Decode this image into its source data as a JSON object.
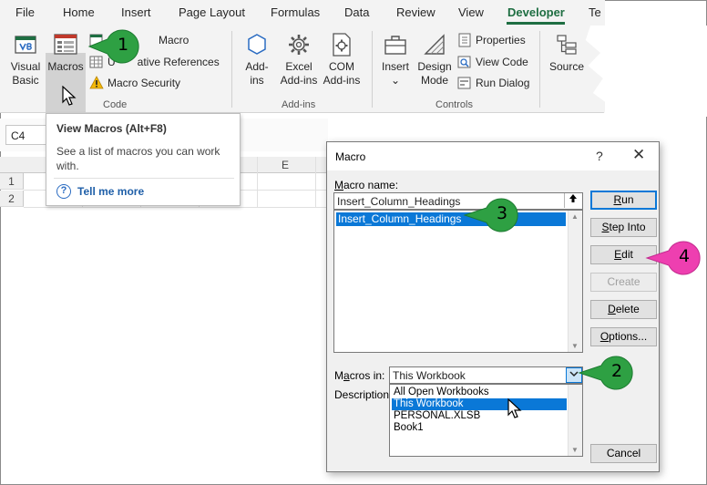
{
  "ribbon": {
    "tabs": [
      "File",
      "Home",
      "Insert",
      "Page Layout",
      "Formulas",
      "Data",
      "Review",
      "View",
      "Developer",
      "Te"
    ],
    "active_tab": "Developer",
    "accent": "#1e6e42",
    "code_group": {
      "visual_basic": [
        "Visual",
        "Basic"
      ],
      "macros": "Macros",
      "record_macro": "Macro",
      "relative_refs": "Use Relative References",
      "relative_refs_visible": "ative References",
      "relative_refs_prefix": "U",
      "macro_security": "Macro Security",
      "label": "Code"
    },
    "addins_group": {
      "addins": [
        "Add-",
        "ins"
      ],
      "excel_addins": [
        "Excel",
        "Add-ins"
      ],
      "com_addins": [
        "COM",
        "Add-ins"
      ],
      "label": "Add-ins"
    },
    "controls_group": {
      "insert": "Insert",
      "design_mode": [
        "Design",
        "Mode"
      ],
      "properties": "Properties",
      "view_code": "View Code",
      "run_dialog": "Run Dialog",
      "label": "Controls"
    },
    "xml_group": {
      "source": "Source"
    }
  },
  "sheet": {
    "name_box": "C4",
    "column_e": "E",
    "rows": [
      "1",
      "2"
    ]
  },
  "tooltip": {
    "title": "View Macros (Alt+F8)",
    "description": "See a list of macros you can work with.",
    "link": "Tell me more"
  },
  "dialog": {
    "title": "Macro",
    "help": "?",
    "close": "✕",
    "macro_name_label_accel": "M",
    "macro_name_label_rest": "acro name:",
    "macro_name_value": "Insert_Column_Headings",
    "macro_list": [
      "Insert_Column_Headings"
    ],
    "buttons": {
      "run": {
        "accel": "R",
        "rest": "un"
      },
      "step_into": {
        "accel": "S",
        "rest": "tep Into"
      },
      "edit": {
        "accel": "E",
        "rest": "dit"
      },
      "create": "Create",
      "delete": {
        "accel": "D",
        "rest": "elete"
      },
      "options": {
        "accel": "O",
        "rest": "ptions..."
      },
      "cancel": "Cancel"
    },
    "macros_in_label_pre": "M",
    "macros_in_label_accel": "a",
    "macros_in_label_rest": "cros in:",
    "macros_in_value": "This Workbook",
    "macros_in_options": [
      "All Open Workbooks",
      "This Workbook",
      "PERSONAL.XLSB",
      "Book1"
    ],
    "macros_in_selected": "This Workbook",
    "description_label": "Description"
  },
  "callouts": [
    {
      "number": "1",
      "color": "#2ea043"
    },
    {
      "number": "2",
      "color": "#2ea043"
    },
    {
      "number": "3",
      "color": "#2ea043"
    },
    {
      "number": "4",
      "color": "#ee3fb0"
    }
  ]
}
